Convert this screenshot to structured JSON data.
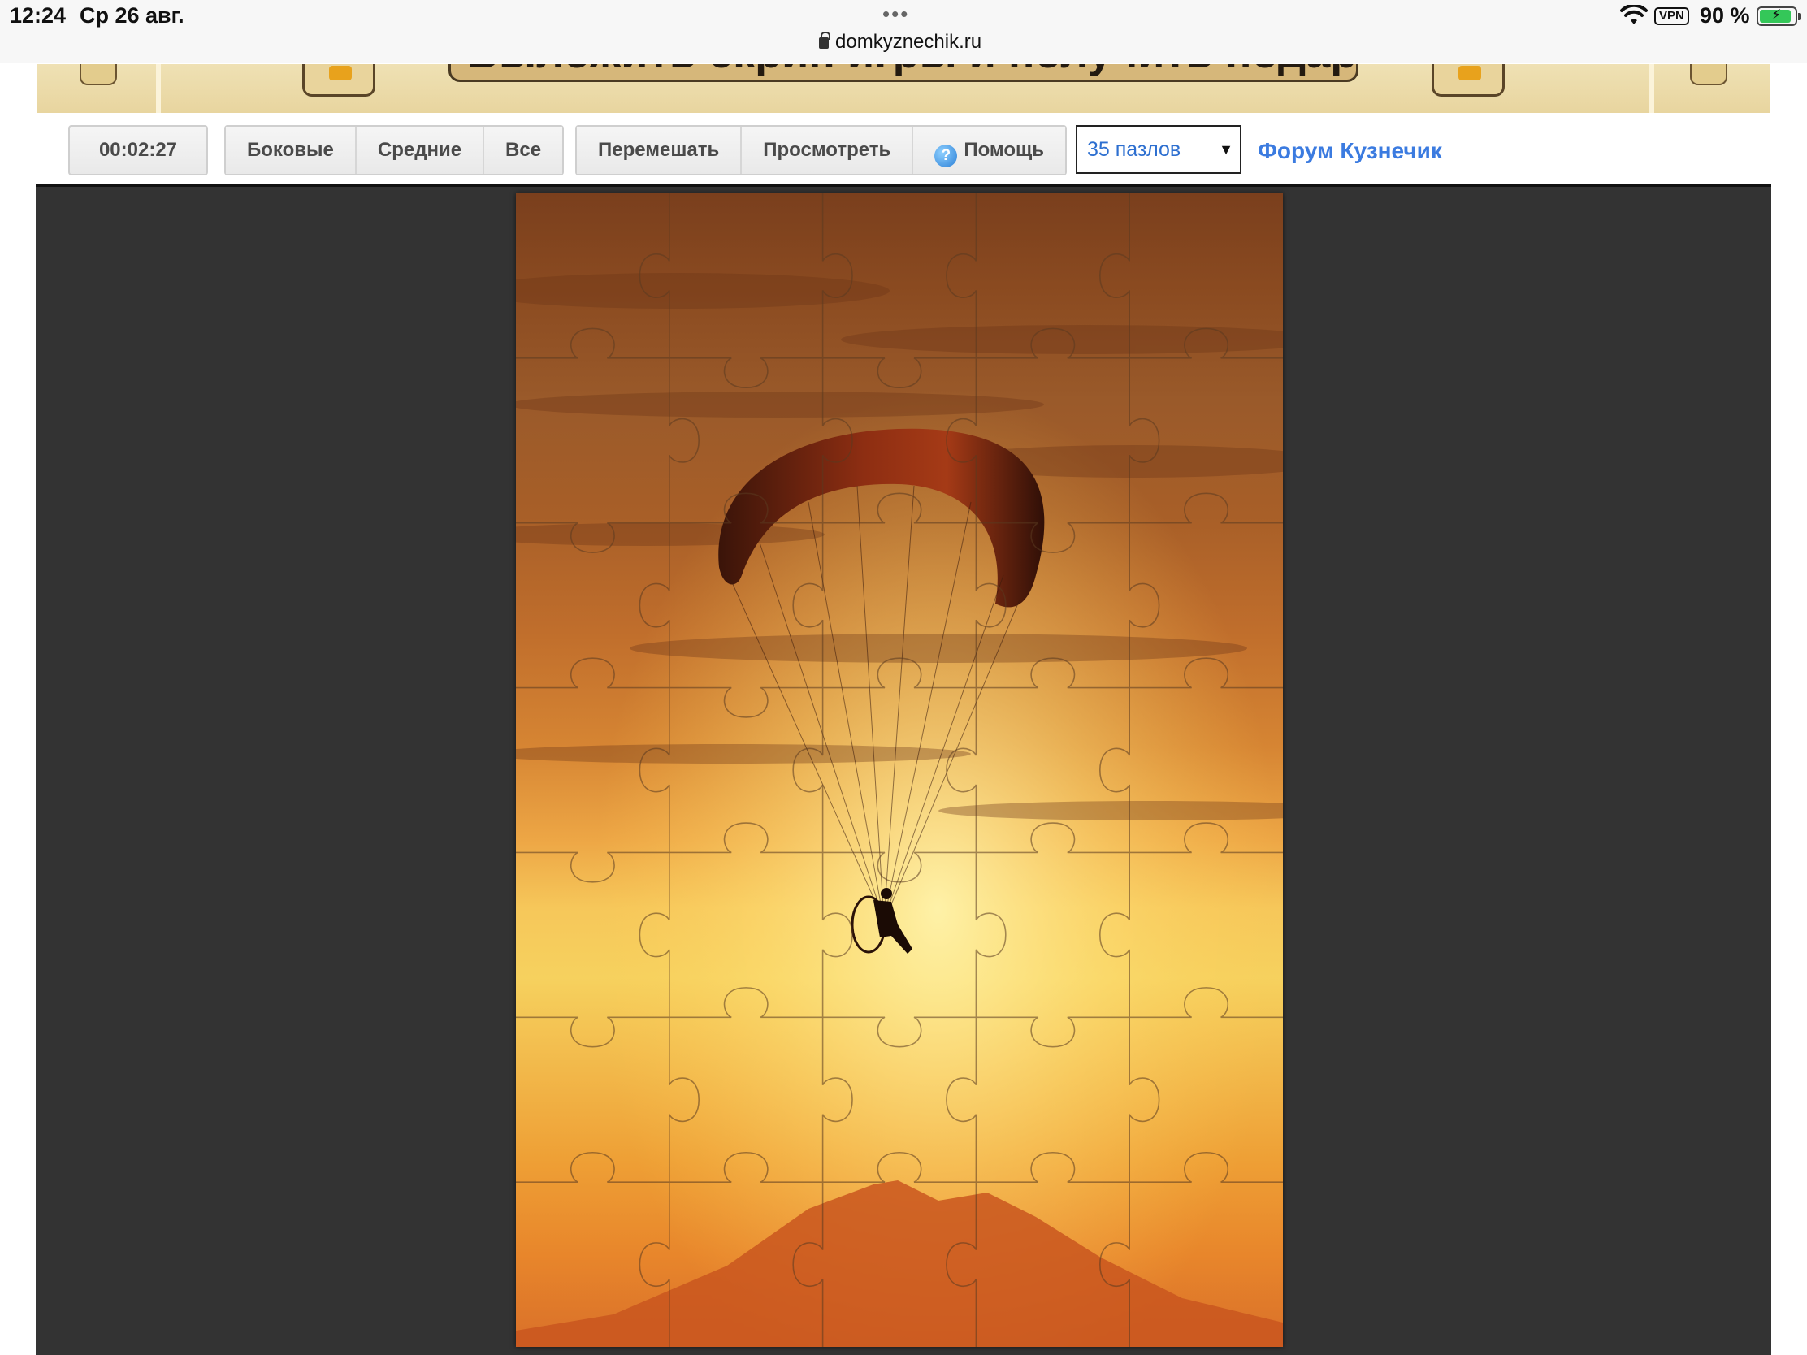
{
  "status_bar": {
    "time": "12:24",
    "date": "Ср 26 авг.",
    "url": "domkyznechik.ru",
    "vpn": "VPN",
    "battery_percent": "90 %",
    "battery_level": 0.9,
    "icons": [
      "lock-icon",
      "wifi-icon",
      "battery-icon"
    ]
  },
  "banner": {
    "text": "Выложить скрин игры и получить подарок"
  },
  "toolbar": {
    "timer": "00:02:27",
    "filter_buttons": [
      "Боковые",
      "Средние",
      "Все"
    ],
    "action_buttons": {
      "shuffle": "Перемешать",
      "preview": "Просмотреть",
      "help": "Помощь"
    },
    "help_icon_glyph": "?",
    "pieces_select": {
      "selected": "35 пазлов",
      "caret": "▼"
    },
    "forum_link": "Форум Кузнечик"
  },
  "puzzle": {
    "columns": 5,
    "rows": 7,
    "pieces_total": 35,
    "image_subject": "paramotor-sunset-icon"
  },
  "colors": {
    "board_background": "#333333",
    "link": "#3b7be0",
    "select_text": "#2d6fd0",
    "banner": "#e8d59f"
  }
}
